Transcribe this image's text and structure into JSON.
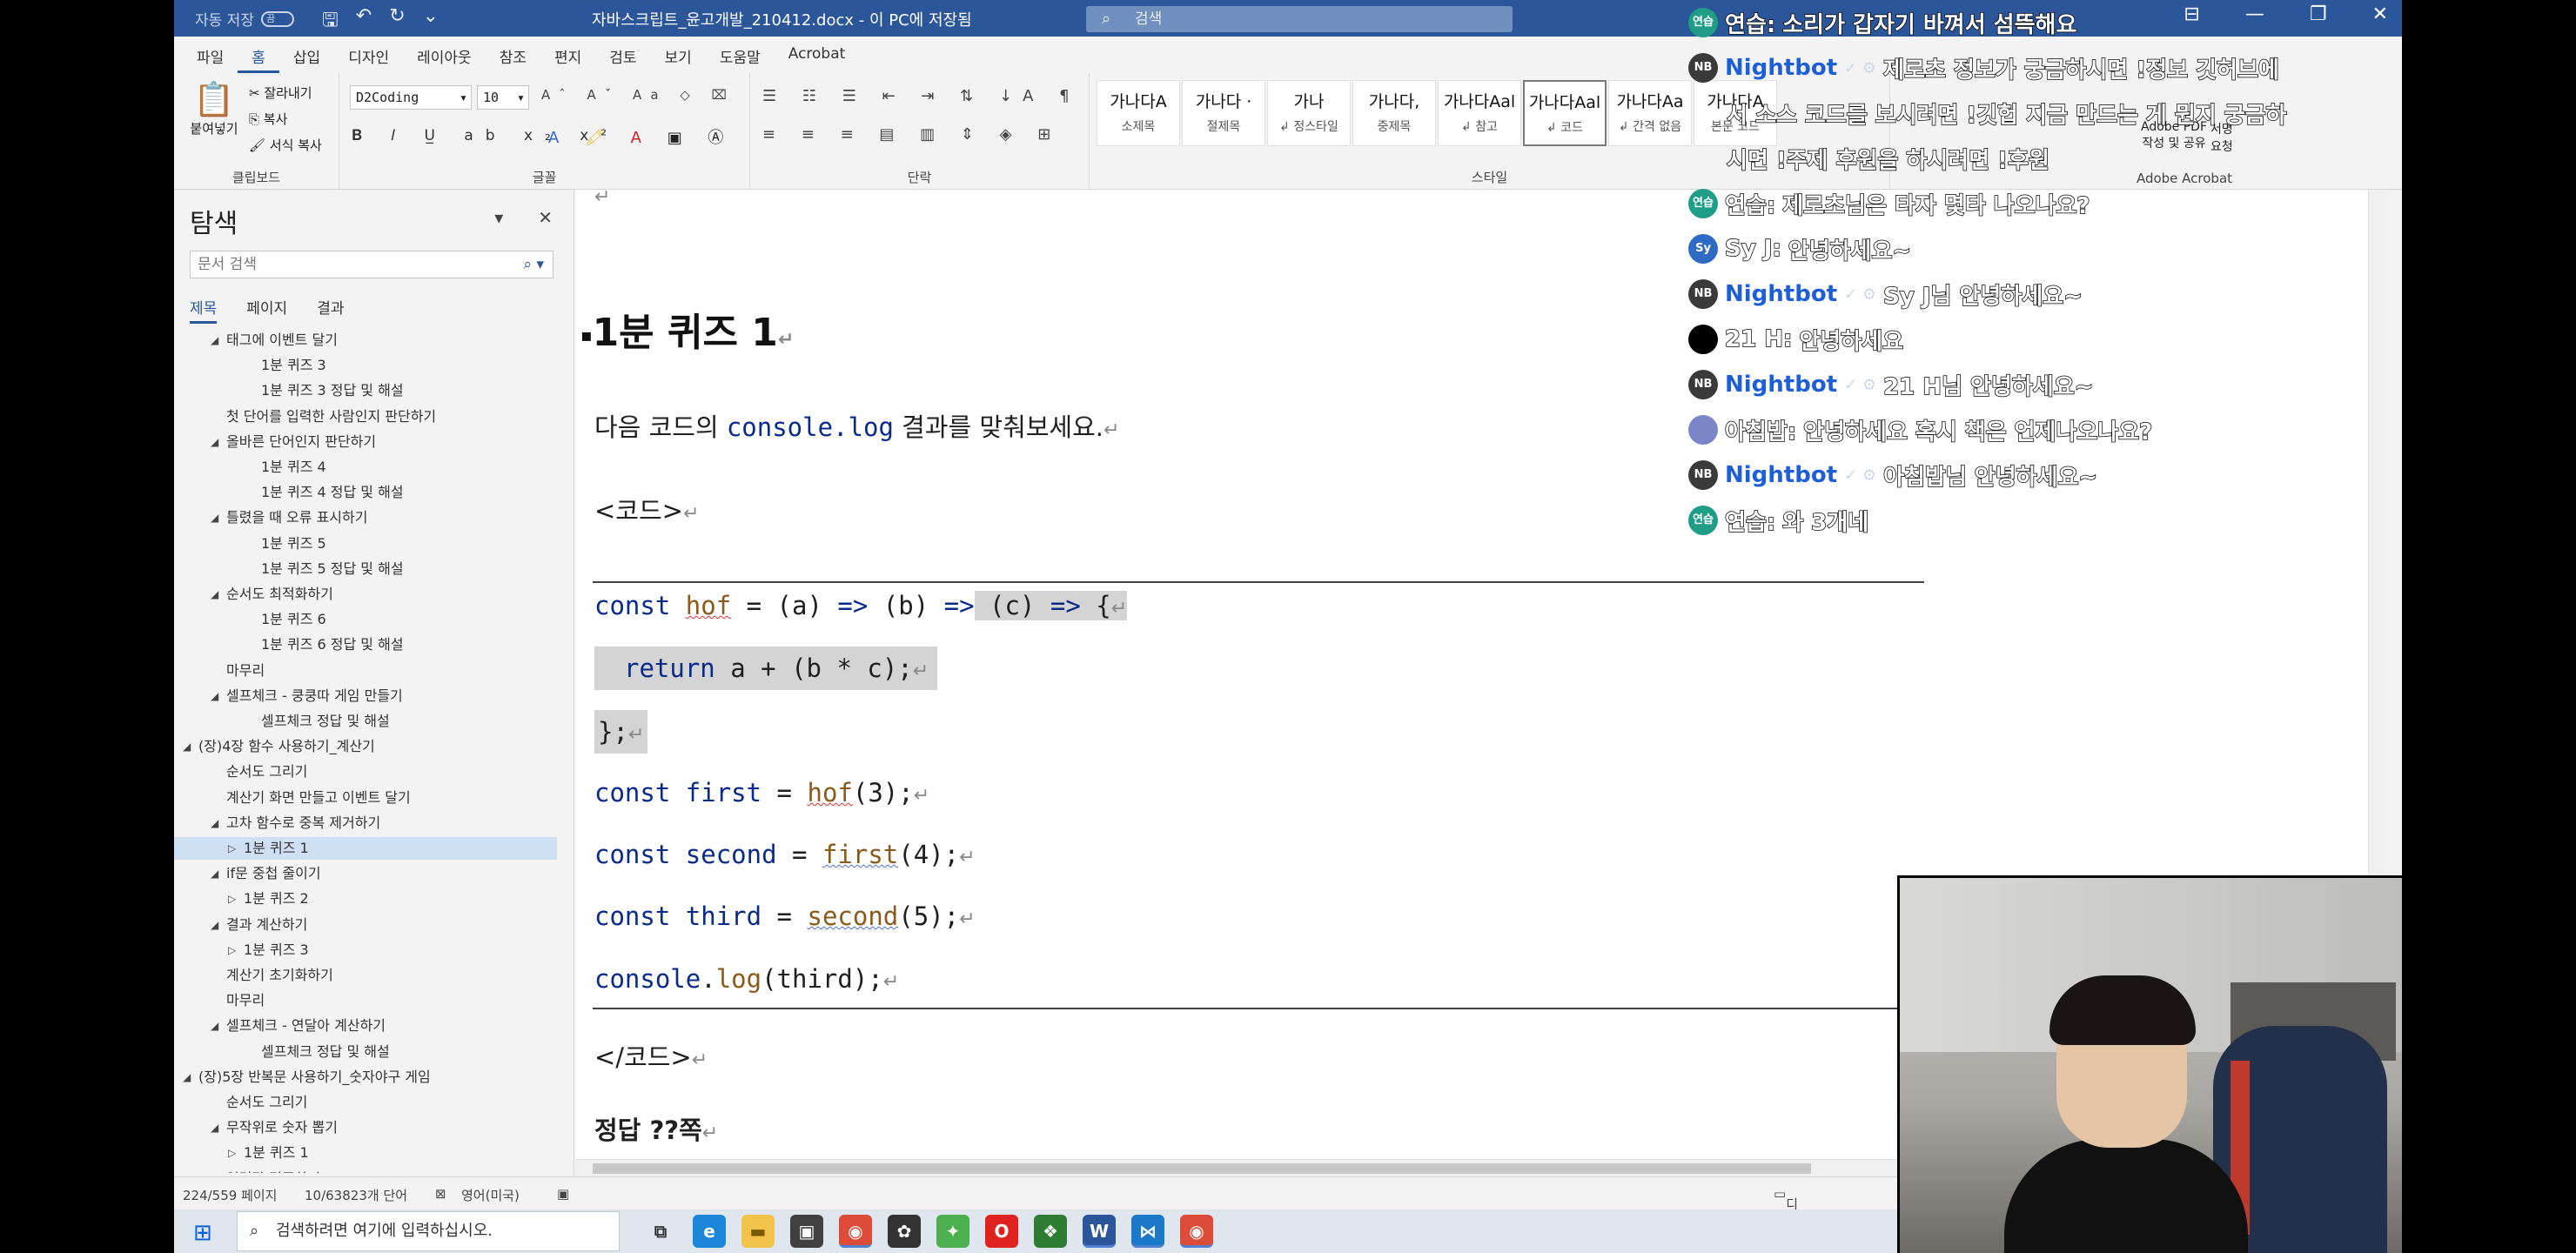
{
  "titlebar": {
    "autosave_label": "자동 저장",
    "autosave_state": "끔",
    "doc_title": "자바스크립트_윤고개발_210412.docx - 이 PC에 저장됨",
    "search_placeholder": "검색"
  },
  "ribbon": {
    "tabs": [
      "파일",
      "홈",
      "삽입",
      "디자인",
      "레이아웃",
      "참조",
      "편지",
      "검토",
      "보기",
      "도움말",
      "Acrobat"
    ],
    "active_tab": "홈",
    "clipboard": {
      "paste": "붙여넣기",
      "cut": "잘라내기",
      "copy": "복사",
      "format_painter": "서식 복사",
      "group_label": "클립보드"
    },
    "font": {
      "font_name": "D2Coding",
      "font_size": "10",
      "group_label": "글꼴"
    },
    "paragraph_label": "단락",
    "styles": [
      {
        "sample": "가나다A",
        "name": "소제목"
      },
      {
        "sample": "가나다 ·",
        "name": "절제목"
      },
      {
        "sample": "가나",
        "name": "↲ 정스타일"
      },
      {
        "sample": "가나다,",
        "name": "중제목"
      },
      {
        "sample": "가나다Aal",
        "name": "↲ 참고"
      },
      {
        "sample": "가나다Aal",
        "name": "↲ 코드"
      },
      {
        "sample": "가나다Aa",
        "name": "↲ 간격 없음"
      },
      {
        "sample": "가나다A",
        "name": "본문 코드"
      }
    ],
    "styles_label": "스타일",
    "adobe": {
      "line1": "Adobe PDF",
      "line2": "작성 및 공유",
      "sign": "서명",
      "sign2": "요청",
      "group_label": "Adobe Acrobat"
    }
  },
  "nav": {
    "title": "탐색",
    "search_placeholder": "문서 검색",
    "tabs": [
      "제목",
      "페이지",
      "결과"
    ],
    "active_tab": "제목",
    "items": [
      {
        "text": "태그에 이벤트 달기",
        "level": 2,
        "tri": "◢"
      },
      {
        "text": "1분 퀴즈 3",
        "level": 3,
        "tri": ""
      },
      {
        "text": "1분 퀴즈 3 정답 및 해설",
        "level": 3,
        "tri": ""
      },
      {
        "text": "첫 단어를 입력한 사람인지 판단하기",
        "level": 2,
        "tri": ""
      },
      {
        "text": "올바른 단어인지 판단하기",
        "level": 2,
        "tri": "◢"
      },
      {
        "text": "1분 퀴즈 4",
        "level": 3,
        "tri": ""
      },
      {
        "text": "1분 퀴즈 4 정답 및 해설",
        "level": 3,
        "tri": ""
      },
      {
        "text": "틀렸을 때 오류 표시하기",
        "level": 2,
        "tri": "◢"
      },
      {
        "text": "1분 퀴즈 5",
        "level": 3,
        "tri": ""
      },
      {
        "text": "1분 퀴즈 5 정답 및 해설",
        "level": 3,
        "tri": ""
      },
      {
        "text": "순서도 최적화하기",
        "level": 2,
        "tri": "◢"
      },
      {
        "text": "1분 퀴즈 6",
        "level": 3,
        "tri": ""
      },
      {
        "text": "1분 퀴즈 6 정답 및 해설",
        "level": 3,
        "tri": ""
      },
      {
        "text": "마무리",
        "level": 2,
        "tri": ""
      },
      {
        "text": "셀프체크 - 쿵쿵따 게임 만들기",
        "level": 2,
        "tri": "◢"
      },
      {
        "text": "셀프체크 정답 및 해설",
        "level": 3,
        "tri": ""
      },
      {
        "text": "(장)4장 함수 사용하기_계산기",
        "level": 1,
        "tri": "◢"
      },
      {
        "text": "순서도 그리기",
        "level": 2,
        "tri": ""
      },
      {
        "text": "계산기 화면 만들고 이벤트 달기",
        "level": 2,
        "tri": ""
      },
      {
        "text": "고차 함수로 중복 제거하기",
        "level": 2,
        "tri": "◢"
      },
      {
        "text": "1분 퀴즈 1",
        "level": "2b",
        "tri": "▷",
        "selected": true
      },
      {
        "text": "if문 중첩 줄이기",
        "level": 2,
        "tri": "◢"
      },
      {
        "text": "1분 퀴즈 2",
        "level": "2b",
        "tri": "▷"
      },
      {
        "text": "결과 계산하기",
        "level": 2,
        "tri": "◢"
      },
      {
        "text": "1분 퀴즈 3",
        "level": "2b",
        "tri": "▷"
      },
      {
        "text": "계산기 초기화하기",
        "level": 2,
        "tri": ""
      },
      {
        "text": "마무리",
        "level": 2,
        "tri": ""
      },
      {
        "text": "셀프체크 - 연달아 계산하기",
        "level": 2,
        "tri": "◢"
      },
      {
        "text": "셀프체크 정답 및 해설",
        "level": 3,
        "tri": ""
      },
      {
        "text": "(장)5장 반복문 사용하기_숫자야구 게임",
        "level": 1,
        "tri": "◢"
      },
      {
        "text": "순서도 그리기",
        "level": 2,
        "tri": ""
      },
      {
        "text": "무작위로 숫자 뽑기",
        "level": 2,
        "tri": "◢"
      },
      {
        "text": "1분 퀴즈 1",
        "level": "2b",
        "tri": "▷"
      },
      {
        "text": "입력값 검증하기",
        "level": 2,
        "tri": ""
      }
    ]
  },
  "document": {
    "heading": "1분 퀴즈 1",
    "intro_prefix": "다음 코드의 ",
    "intro_code": "console.log",
    "intro_suffix": " 결과를 맞춰보세요.",
    "code_open": "<코드>",
    "code_close": "</코드>",
    "answer": "정답 ??쪽",
    "code": {
      "l1_kw": "const",
      "l1_name": "hof",
      "l1_rest_a": " = (a) ",
      "l1_arrow1": "=>",
      "l1_rest_b": " (b) ",
      "l1_arrow2": "=>",
      "l1_rest_c": " (c) ",
      "l1_arrow3": "=>",
      "l1_rest_d": " {",
      "l2_kw": "return",
      "l2_rest": " a + (b * c);",
      "l3": "};",
      "l4_kw": "const",
      "l4_name": "first",
      "l4_eq": " = ",
      "l4_call": "hof",
      "l4_arg": "(3);",
      "l5_kw": "const",
      "l5_name": "second",
      "l5_eq": " = ",
      "l5_call": "first",
      "l5_arg": "(4);",
      "l6_kw": "const",
      "l6_name": "third",
      "l6_eq": " = ",
      "l6_call": "second",
      "l6_arg": "(5);",
      "l7_obj": "console",
      "l7_dot": ".",
      "l7_fn": "log",
      "l7_arg": "(third);"
    }
  },
  "statusbar": {
    "pages": "224/559 페이지",
    "words": "10/63823개 단어",
    "language": "영어(미국)",
    "display": "디스플"
  },
  "taskbar": {
    "search_placeholder": "검색하려면 여기에 입력하십시오."
  },
  "chat": [
    {
      "badge": "연습",
      "badge_color": "#1f9d86",
      "user": "연습:",
      "msg": "소리가 갑자기 바껴서 섬뜩해요",
      "bot": false
    },
    {
      "badge": "NB",
      "badge_color": "#3a3a3a",
      "user": "Nightbot",
      "msg": "제로초 정보가 궁금하시면 !정보 깃허브에",
      "bot": true
    },
    {
      "badge": "",
      "badge_color": "transparent",
      "user": "",
      "msg": "서 소스 코드를 보시려면 !깃헙 지금 만드는 게 뭔지 궁금하",
      "bot": false,
      "cont": true
    },
    {
      "badge": "",
      "badge_color": "transparent",
      "user": "",
      "msg": "시면 !주제 후원을 하시려면 !후원",
      "bot": false,
      "cont": true
    },
    {
      "badge": "연습",
      "badge_color": "#1f9d86",
      "user": "연습:",
      "msg": "제로초님은 타자 몇타 나오나요?",
      "bot": false
    },
    {
      "badge": "Sy",
      "badge_color": "#2f6bc4",
      "user": "Sy J:",
      "msg": "안녕하세요~",
      "bot": false
    },
    {
      "badge": "NB",
      "badge_color": "#3a3a3a",
      "user": "Nightbot",
      "msg": "Sy J님 안녕하세요~",
      "bot": true
    },
    {
      "badge": "",
      "badge_color": "#000000",
      "user": "21 H:",
      "msg": "안녕하세요",
      "bot": false
    },
    {
      "badge": "NB",
      "badge_color": "#3a3a3a",
      "user": "Nightbot",
      "msg": "21 H님 안녕하세요~",
      "bot": true
    },
    {
      "badge": "",
      "badge_color": "#7b86c9",
      "user": "아침밥:",
      "msg": "안녕하세요 혹시 책은 언제나오나요?",
      "bot": false
    },
    {
      "badge": "NB",
      "badge_color": "#3a3a3a",
      "user": "Nightbot",
      "msg": "아침밥님 안녕하세요~",
      "bot": true
    },
    {
      "badge": "연습",
      "badge_color": "#1f9d86",
      "user": "연습:",
      "msg": "와 3개네",
      "bot": false
    }
  ]
}
